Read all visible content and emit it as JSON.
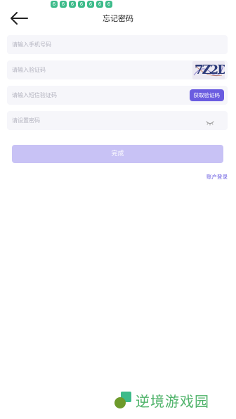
{
  "status_bar": {
    "notification_icons": [
      "6",
      "6",
      "6",
      "6",
      "6",
      "6",
      "6"
    ],
    "icon_color": "#3dbb8a"
  },
  "header": {
    "back_icon": "arrow-left-icon",
    "title": "忘记密码"
  },
  "form": {
    "phone": {
      "placeholder": "请输入手机号码",
      "value": ""
    },
    "captcha": {
      "placeholder": "请输入验证码",
      "value": "",
      "image_text": "7Z2D"
    },
    "sms": {
      "placeholder": "请输入短信验证码",
      "value": "",
      "button_label": "获取验证码"
    },
    "password": {
      "placeholder": "请设置密码",
      "value": "",
      "toggle_icon": "eye-closed-icon"
    }
  },
  "submit_label": "完成",
  "login_link": "账户登录",
  "watermark": {
    "text": "逆境游戏园"
  },
  "colors": {
    "accent": "#6a5ce0",
    "submit_disabled": "#c8c2f5",
    "field_bg": "#f6f6fa"
  }
}
